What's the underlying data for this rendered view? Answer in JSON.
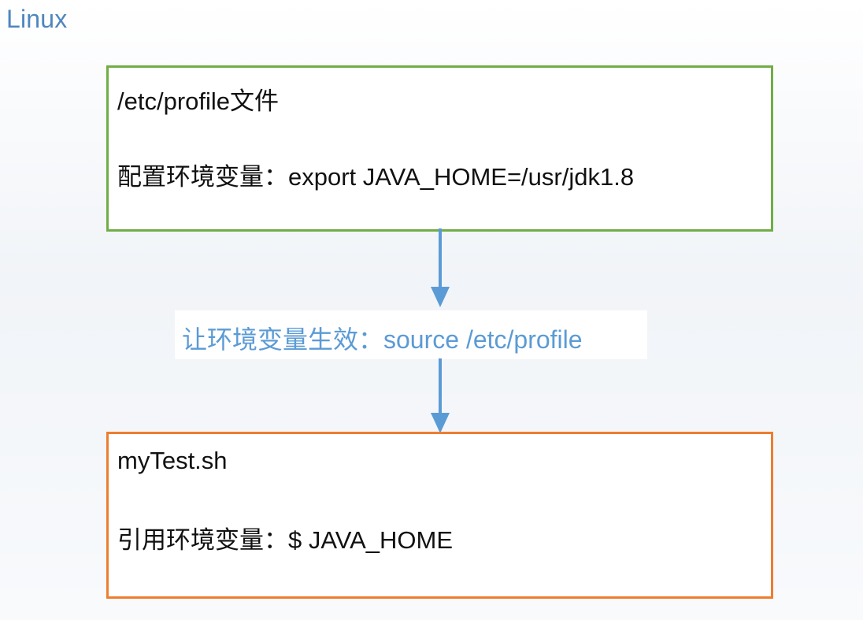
{
  "title": "Linux",
  "top_box": {
    "line1": "/etc/profile文件",
    "line2": "配置环境变量：export JAVA_HOME=/usr/jdk1.8"
  },
  "middle_label": "让环境变量生效：source /etc/profile",
  "bottom_box": {
    "line1": "myTest.sh",
    "line2": "引用环境变量：$ JAVA_HOME"
  },
  "colors": {
    "top_box_border": "#70ad47",
    "bottom_box_border": "#ed7d31",
    "arrow": "#5b9bd5",
    "label": "#5b9bd5",
    "title": "#4f86bd"
  }
}
